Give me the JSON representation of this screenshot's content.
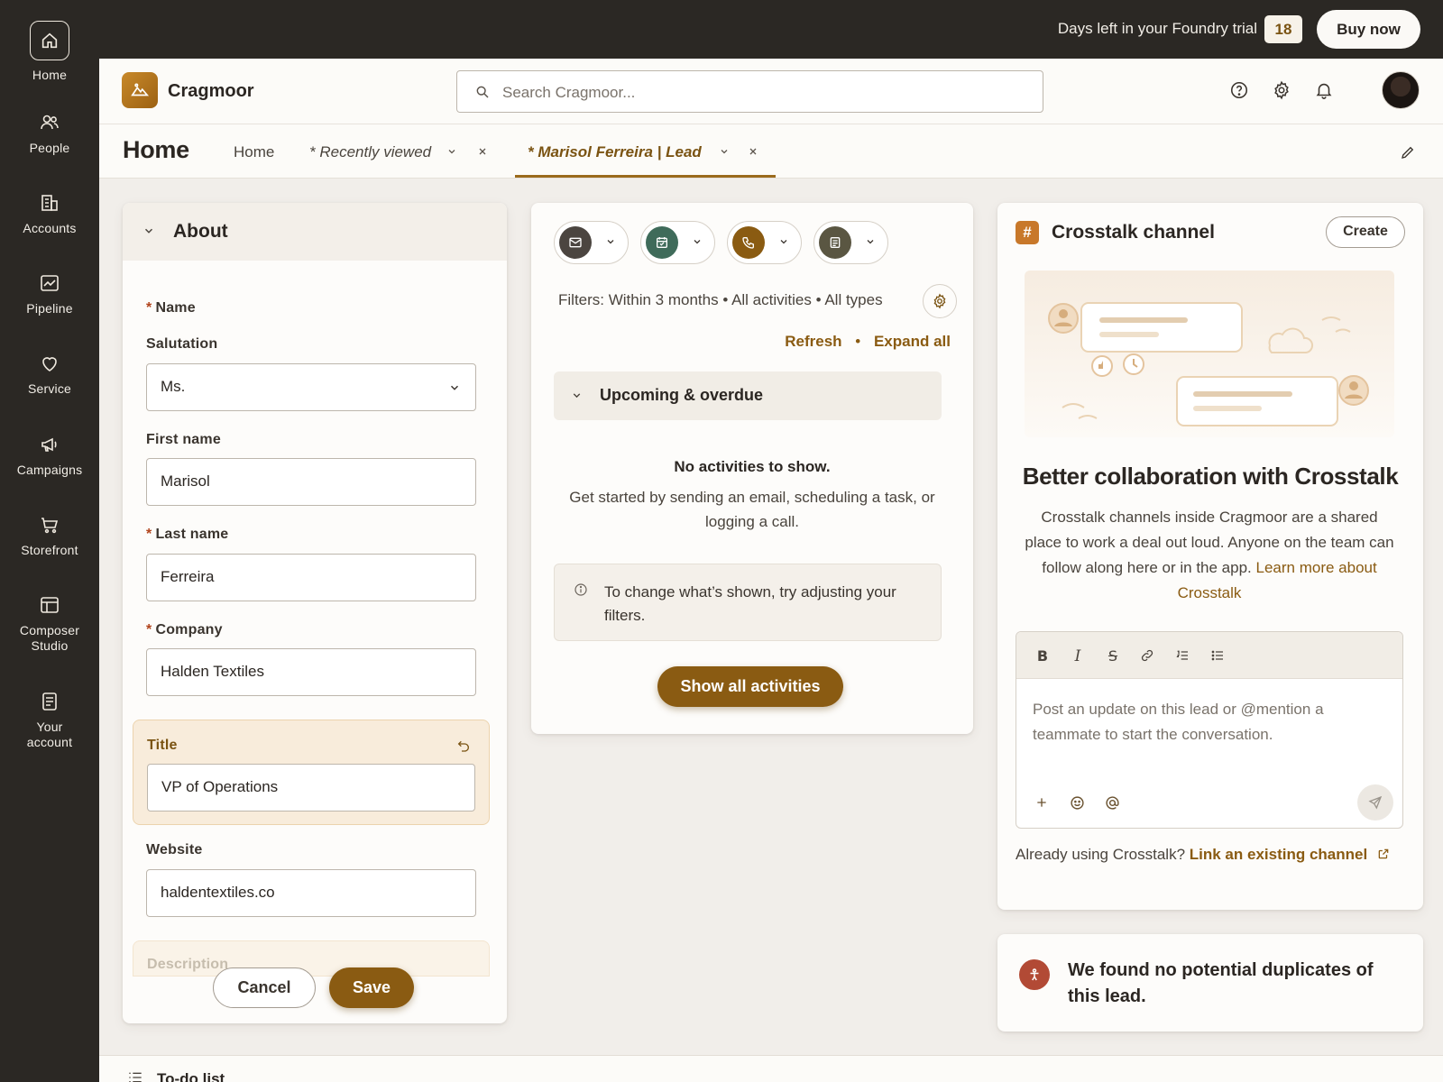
{
  "rail": {
    "items": [
      {
        "label": "Home",
        "icon": "home-icon"
      },
      {
        "label": "People",
        "icon": "people-icon"
      },
      {
        "label": "Accounts",
        "icon": "building-icon"
      },
      {
        "label": "Pipeline",
        "icon": "chart-icon"
      },
      {
        "label": "Service",
        "icon": "heart-icon"
      },
      {
        "label": "Campaigns",
        "icon": "megaphone-icon"
      },
      {
        "label": "Storefront",
        "icon": "cart-icon"
      },
      {
        "label": "Composer Studio",
        "icon": "layout-icon"
      },
      {
        "label": "Your account",
        "icon": "receipt-icon"
      }
    ]
  },
  "topbar": {
    "trial_text": "Days left in your Foundry trial",
    "trial_days": "18",
    "buy_label": "Buy now"
  },
  "header": {
    "app_name": "Cragmoor",
    "search_placeholder": "Search Cragmoor..."
  },
  "tabs": {
    "page_title": "Home",
    "items": [
      {
        "label": "Home"
      },
      {
        "label": "* Recently viewed"
      },
      {
        "label": "* Marisol Ferreira | Lead"
      }
    ]
  },
  "about": {
    "title": "About",
    "name_section": "Name",
    "salutation_label": "Salutation",
    "salutation_value": "Ms.",
    "first_name_label": "First name",
    "first_name_value": "Marisol",
    "last_name_label": "Last name",
    "last_name_value": "Ferreira",
    "company_label": "Company",
    "company_value": "Halden Textiles",
    "title_label": "Title",
    "title_value": "VP of Operations",
    "website_label": "Website",
    "website_value": "haldentextiles.co",
    "description_label": "Description",
    "cancel_label": "Cancel",
    "save_label": "Save"
  },
  "activity": {
    "filters_text": "Filters: Within 3 months • All activities • All types",
    "refresh_label": "Refresh",
    "expand_label": "Expand all",
    "section_label": "Upcoming & overdue",
    "empty_title": "No activities to show.",
    "empty_body": "Get started by sending an email, scheduling a task, or logging a call.",
    "info_text": "To change what’s shown, try adjusting your filters.",
    "show_all_label": "Show all activities",
    "colors": {
      "email": "#4b4540",
      "event": "#3f6b5a",
      "call": "#8a5b12",
      "task": "#5a5642"
    }
  },
  "crosstalk": {
    "title": "Crosstalk channel",
    "create_label": "Create",
    "heading": "Better collaboration with Crosstalk",
    "body": "Crosstalk channels inside Cragmoor are a shared place to work a deal out loud. Anyone on the team can follow along here or in the app.",
    "learn_more": "Learn more about Crosstalk",
    "editor_placeholder": "Post an update on this lead or @mention a teammate to start the conversation.",
    "already_text": "Already using Crosstalk?",
    "link_existing": "Link an existing channel"
  },
  "duplicates": {
    "text": "We found no potential duplicates of this lead."
  },
  "footer": {
    "todo_label": "To-do list"
  },
  "accent": "#8a5b12"
}
